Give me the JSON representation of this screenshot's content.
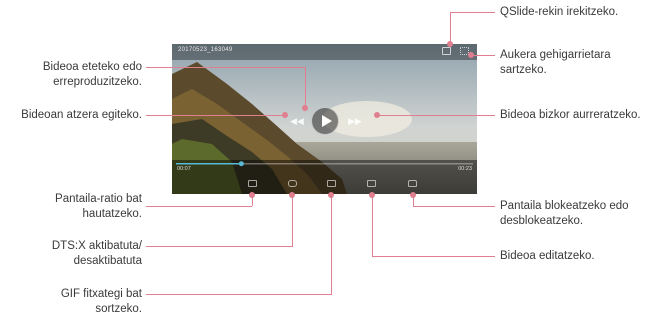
{
  "player": {
    "title": "20170523_163049",
    "time_elapsed": "00:07",
    "time_total": "00:23",
    "progress_fraction": 0.22,
    "accent": "#5ab9d6"
  },
  "callouts": {
    "qslide": "QSlide-rekin irekitzeko.",
    "more_options_1": "Aukera gehigarrietara",
    "more_options_2": "sartzeko.",
    "play_pause_1": "Bideoa eteteko edo",
    "play_pause_2": "erreproduzitzeko.",
    "rewind": "Bideoan atzera egiteko.",
    "fast_forward": "Bideoa bizkor aurreratzeko.",
    "ratio_1": "Pantaila-ratio bat",
    "ratio_2": "hautatzeko.",
    "lock_1": "Pantaila blokeatzeko edo",
    "lock_2": "desblokeatzeko.",
    "dtsx_1": "DTS:X aktibatuta/",
    "dtsx_2": "desaktibatuta",
    "edit": "Bideoa editatzeko.",
    "gif_1": "GIF fitxategi bat",
    "gif_2": "sortzeko."
  },
  "colors": {
    "callout_line": "#e07f8f"
  }
}
